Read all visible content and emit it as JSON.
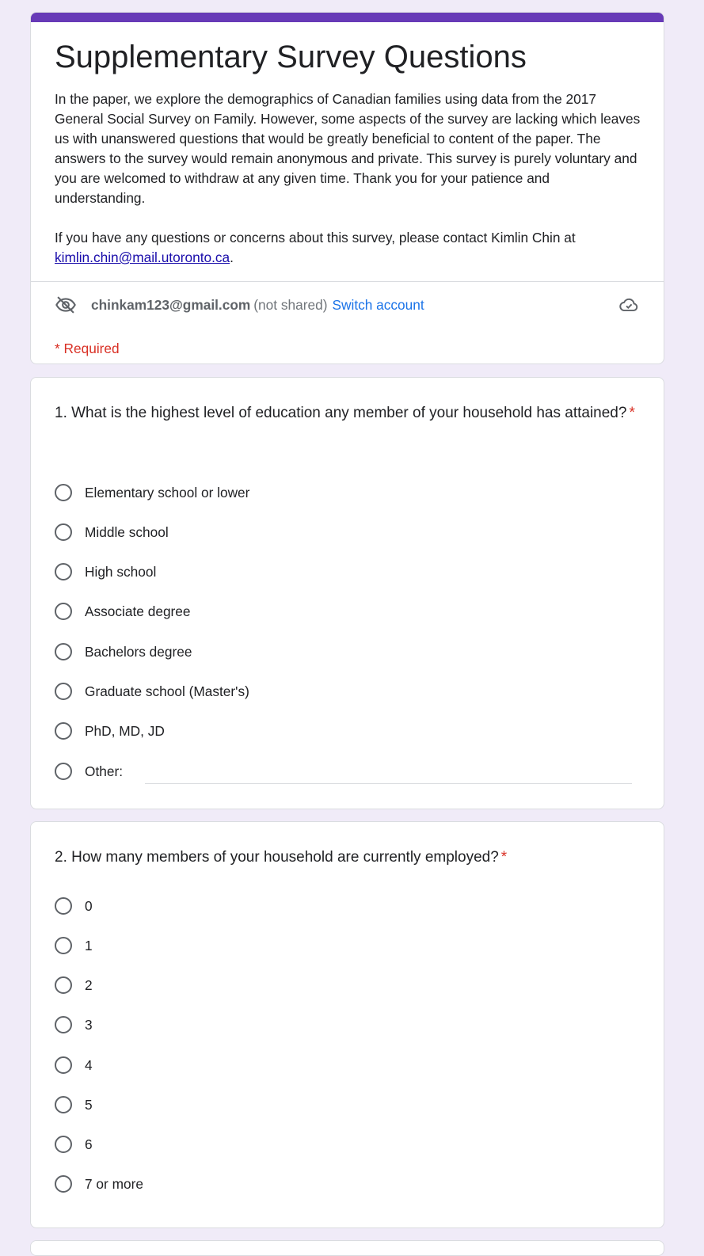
{
  "form": {
    "title": "Supplementary Survey Questions",
    "description_p1": "In the paper, we explore the demographics of Canadian families using data from the 2017 General Social Survey on Family. However, some aspects of the survey are lacking which leaves us with unanswered questions that would be greatly beneficial to content of the paper. The answers to the survey would remain anonymous and private. This survey is purely voluntary and you are welcomed to withdraw at any given time. Thank you for your patience and understanding.",
    "description_p2_prefix": "If you have any questions or concerns about this survey, please contact Kimlin Chin at ",
    "contact_email": "kimlin.chin@mail.utoronto.ca",
    "description_p2_suffix": ".",
    "accent_color": "#673ab7"
  },
  "account": {
    "email": "chinkam123@gmail.com",
    "note": "(not shared)",
    "switch_label": "Switch account",
    "icons": [
      "eye-off-icon",
      "cloud-check-icon"
    ]
  },
  "required_note": "* Required",
  "questions": [
    {
      "title": "1. What is the highest level of education any member of your household has attained?",
      "required_mark": "*",
      "options": [
        "Elementary school or lower",
        "Middle school",
        "High school",
        "Associate degree",
        "Bachelors degree",
        "Graduate school (Master's)",
        "PhD, MD, JD",
        "Other:"
      ],
      "other_value": ""
    },
    {
      "title": "2. How many members of your household are currently employed?",
      "required_mark": "*",
      "options": [
        "0",
        "1",
        "2",
        "3",
        "4",
        "5",
        "6",
        "7 or more"
      ]
    }
  ]
}
